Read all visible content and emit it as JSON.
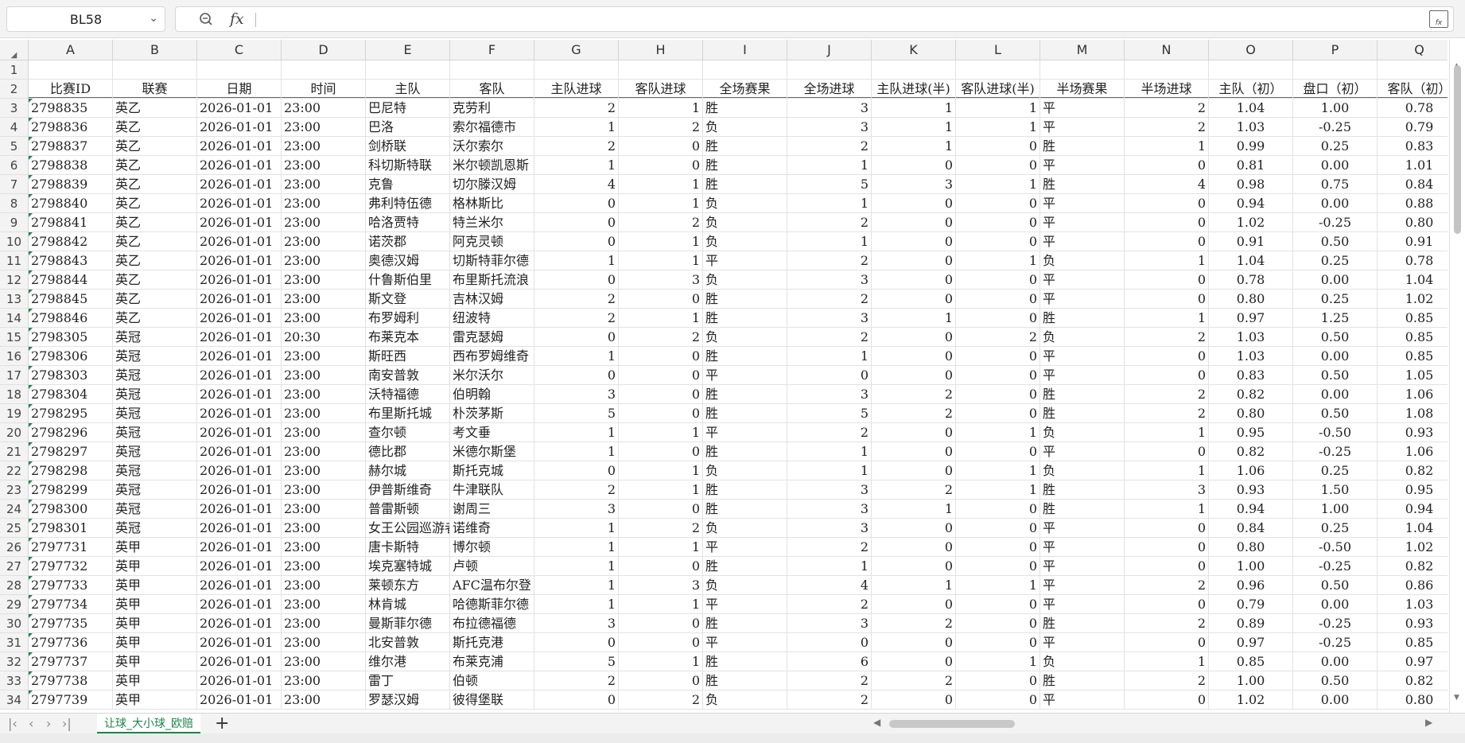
{
  "formula_bar": {
    "cell_ref": "BL58",
    "fx_label": "fx",
    "formula_value": ""
  },
  "columns": [
    "A",
    "B",
    "C",
    "D",
    "E",
    "F",
    "G",
    "H",
    "I",
    "J",
    "K",
    "L",
    "M",
    "N",
    "O",
    "P",
    "Q"
  ],
  "row_numbers": [
    "1",
    "2",
    "3",
    "4",
    "5",
    "6",
    "7",
    "8",
    "9",
    "10",
    "11",
    "12",
    "13",
    "14",
    "15",
    "16",
    "17",
    "18",
    "19",
    "20",
    "21",
    "22",
    "23",
    "24",
    "25",
    "26",
    "27",
    "28",
    "29",
    "30",
    "31",
    "32",
    "33",
    "34"
  ],
  "headers": [
    "比赛ID",
    "联赛",
    "日期",
    "时间",
    "主队",
    "客队",
    "主队进球",
    "客队进球",
    "全场赛果",
    "全场进球",
    "主队进球(半)",
    "客队进球(半)",
    "半场赛果",
    "半场进球",
    "主队（初）",
    "盘口（初）",
    "客队（初）"
  ],
  "data": [
    [
      "2798835",
      "英乙",
      "2026-01-01",
      "23:00",
      "巴尼特",
      "克劳利",
      "2",
      "1",
      "胜",
      "3",
      "1",
      "1",
      "平",
      "2",
      "1.04",
      "1.00",
      "0.78"
    ],
    [
      "2798836",
      "英乙",
      "2026-01-01",
      "23:00",
      "巴洛",
      "索尔福德市",
      "1",
      "2",
      "负",
      "3",
      "1",
      "1",
      "平",
      "2",
      "1.03",
      "-0.25",
      "0.79"
    ],
    [
      "2798837",
      "英乙",
      "2026-01-01",
      "23:00",
      "剑桥联",
      "沃尔索尔",
      "2",
      "0",
      "胜",
      "2",
      "1",
      "0",
      "胜",
      "1",
      "0.99",
      "0.25",
      "0.83"
    ],
    [
      "2798838",
      "英乙",
      "2026-01-01",
      "23:00",
      "科切斯特联",
      "米尔顿凯恩斯",
      "1",
      "0",
      "胜",
      "1",
      "0",
      "0",
      "平",
      "0",
      "0.81",
      "0.00",
      "1.01"
    ],
    [
      "2798839",
      "英乙",
      "2026-01-01",
      "23:00",
      "克鲁",
      "切尔滕汉姆",
      "4",
      "1",
      "胜",
      "5",
      "3",
      "1",
      "胜",
      "4",
      "0.98",
      "0.75",
      "0.84"
    ],
    [
      "2798840",
      "英乙",
      "2026-01-01",
      "23:00",
      "弗利特伍德",
      "格林斯比",
      "0",
      "1",
      "负",
      "1",
      "0",
      "0",
      "平",
      "0",
      "0.94",
      "0.00",
      "0.88"
    ],
    [
      "2798841",
      "英乙",
      "2026-01-01",
      "23:00",
      "哈洛贾特",
      "特兰米尔",
      "0",
      "2",
      "负",
      "2",
      "0",
      "0",
      "平",
      "0",
      "1.02",
      "-0.25",
      "0.80"
    ],
    [
      "2798842",
      "英乙",
      "2026-01-01",
      "23:00",
      "诺茨郡",
      "阿克灵顿",
      "0",
      "1",
      "负",
      "1",
      "0",
      "0",
      "平",
      "0",
      "0.91",
      "0.50",
      "0.91"
    ],
    [
      "2798843",
      "英乙",
      "2026-01-01",
      "23:00",
      "奥德汉姆",
      "切斯特菲尔德",
      "1",
      "1",
      "平",
      "2",
      "0",
      "1",
      "负",
      "1",
      "1.04",
      "0.25",
      "0.78"
    ],
    [
      "2798844",
      "英乙",
      "2026-01-01",
      "23:00",
      "什鲁斯伯里",
      "布里斯托流浪",
      "0",
      "3",
      "负",
      "3",
      "0",
      "0",
      "平",
      "0",
      "0.78",
      "0.00",
      "1.04"
    ],
    [
      "2798845",
      "英乙",
      "2026-01-01",
      "23:00",
      "斯文登",
      "吉林汉姆",
      "2",
      "0",
      "胜",
      "2",
      "0",
      "0",
      "平",
      "0",
      "0.80",
      "0.25",
      "1.02"
    ],
    [
      "2798846",
      "英乙",
      "2026-01-01",
      "23:00",
      "布罗姆利",
      "纽波特",
      "2",
      "1",
      "胜",
      "3",
      "1",
      "0",
      "胜",
      "1",
      "0.97",
      "1.25",
      "0.85"
    ],
    [
      "2798305",
      "英冠",
      "2026-01-01",
      "20:30",
      "布莱克本",
      "雷克瑟姆",
      "0",
      "2",
      "负",
      "2",
      "0",
      "2",
      "负",
      "2",
      "1.03",
      "0.50",
      "0.85"
    ],
    [
      "2798306",
      "英冠",
      "2026-01-01",
      "23:00",
      "斯旺西",
      "西布罗姆维奇",
      "1",
      "0",
      "胜",
      "1",
      "0",
      "0",
      "平",
      "0",
      "1.03",
      "0.00",
      "0.85"
    ],
    [
      "2798303",
      "英冠",
      "2026-01-01",
      "23:00",
      "南安普敦",
      "米尔沃尔",
      "0",
      "0",
      "平",
      "0",
      "0",
      "0",
      "平",
      "0",
      "0.83",
      "0.50",
      "1.05"
    ],
    [
      "2798304",
      "英冠",
      "2026-01-01",
      "23:00",
      "沃特福德",
      "伯明翰",
      "3",
      "0",
      "胜",
      "3",
      "2",
      "0",
      "胜",
      "2",
      "0.82",
      "0.00",
      "1.06"
    ],
    [
      "2798295",
      "英冠",
      "2026-01-01",
      "23:00",
      "布里斯托城",
      "朴茨茅斯",
      "5",
      "0",
      "胜",
      "5",
      "2",
      "0",
      "胜",
      "2",
      "0.80",
      "0.50",
      "1.08"
    ],
    [
      "2798296",
      "英冠",
      "2026-01-01",
      "23:00",
      "查尔顿",
      "考文垂",
      "1",
      "1",
      "平",
      "2",
      "0",
      "1",
      "负",
      "1",
      "0.95",
      "-0.50",
      "0.93"
    ],
    [
      "2798297",
      "英冠",
      "2026-01-01",
      "23:00",
      "德比郡",
      "米德尔斯堡",
      "1",
      "0",
      "胜",
      "1",
      "0",
      "0",
      "平",
      "0",
      "0.82",
      "-0.25",
      "1.06"
    ],
    [
      "2798298",
      "英冠",
      "2026-01-01",
      "23:00",
      "赫尔城",
      "斯托克城",
      "0",
      "1",
      "负",
      "1",
      "0",
      "1",
      "负",
      "1",
      "1.06",
      "0.25",
      "0.82"
    ],
    [
      "2798299",
      "英冠",
      "2026-01-01",
      "23:00",
      "伊普斯维奇",
      "牛津联队",
      "2",
      "1",
      "胜",
      "3",
      "2",
      "1",
      "胜",
      "3",
      "0.93",
      "1.50",
      "0.95"
    ],
    [
      "2798300",
      "英冠",
      "2026-01-01",
      "23:00",
      "普雷斯顿",
      "谢周三",
      "3",
      "0",
      "胜",
      "3",
      "1",
      "0",
      "胜",
      "1",
      "0.94",
      "1.00",
      "0.94"
    ],
    [
      "2798301",
      "英冠",
      "2026-01-01",
      "23:00",
      "女王公园巡游者",
      "诺维奇",
      "1",
      "2",
      "负",
      "3",
      "0",
      "0",
      "平",
      "0",
      "0.84",
      "0.25",
      "1.04"
    ],
    [
      "2797731",
      "英甲",
      "2026-01-01",
      "23:00",
      "唐卡斯特",
      "博尔顿",
      "1",
      "1",
      "平",
      "2",
      "0",
      "0",
      "平",
      "0",
      "0.80",
      "-0.50",
      "1.02"
    ],
    [
      "2797732",
      "英甲",
      "2026-01-01",
      "23:00",
      "埃克塞特城",
      "卢顿",
      "1",
      "0",
      "胜",
      "1",
      "0",
      "0",
      "平",
      "0",
      "1.00",
      "-0.25",
      "0.82"
    ],
    [
      "2797733",
      "英甲",
      "2026-01-01",
      "23:00",
      "莱顿东方",
      "AFC温布尔登",
      "1",
      "3",
      "负",
      "4",
      "1",
      "1",
      "平",
      "2",
      "0.96",
      "0.50",
      "0.86"
    ],
    [
      "2797734",
      "英甲",
      "2026-01-01",
      "23:00",
      "林肯城",
      "哈德斯菲尔德",
      "1",
      "1",
      "平",
      "2",
      "0",
      "0",
      "平",
      "0",
      "0.79",
      "0.00",
      "1.03"
    ],
    [
      "2797735",
      "英甲",
      "2026-01-01",
      "23:00",
      "曼斯菲尔德",
      "布拉德福德",
      "3",
      "0",
      "胜",
      "3",
      "2",
      "0",
      "胜",
      "2",
      "0.89",
      "-0.25",
      "0.93"
    ],
    [
      "2797736",
      "英甲",
      "2026-01-01",
      "23:00",
      "北安普敦",
      "斯托克港",
      "0",
      "0",
      "平",
      "0",
      "0",
      "0",
      "平",
      "0",
      "0.97",
      "-0.25",
      "0.85"
    ],
    [
      "2797737",
      "英甲",
      "2026-01-01",
      "23:00",
      "维尔港",
      "布莱克浦",
      "5",
      "1",
      "胜",
      "6",
      "0",
      "1",
      "负",
      "1",
      "0.85",
      "0.00",
      "0.97"
    ],
    [
      "2797738",
      "英甲",
      "2026-01-01",
      "23:00",
      "雷丁",
      "伯顿",
      "2",
      "0",
      "胜",
      "2",
      "2",
      "0",
      "胜",
      "2",
      "1.00",
      "0.50",
      "0.82"
    ],
    [
      "2797739",
      "英甲",
      "2026-01-01",
      "23:00",
      "罗瑟汉姆",
      "彼得堡联",
      "0",
      "2",
      "负",
      "2",
      "0",
      "0",
      "平",
      "0",
      "1.02",
      "0.00",
      "0.80"
    ]
  ],
  "sheet_tabs": [
    {
      "name": "让球_大小球_欧赔",
      "active": true
    }
  ],
  "colors": {
    "accent": "#1e8449",
    "header_bg": "#f3f3f3",
    "grid_line": "#e2e2e2"
  },
  "icons": {
    "zoom": "magnifier-icon",
    "fx": "function-icon",
    "formula_expand": "fx-box-icon",
    "add_sheet": "plus-icon",
    "dropdown": "chevron-down-icon"
  }
}
